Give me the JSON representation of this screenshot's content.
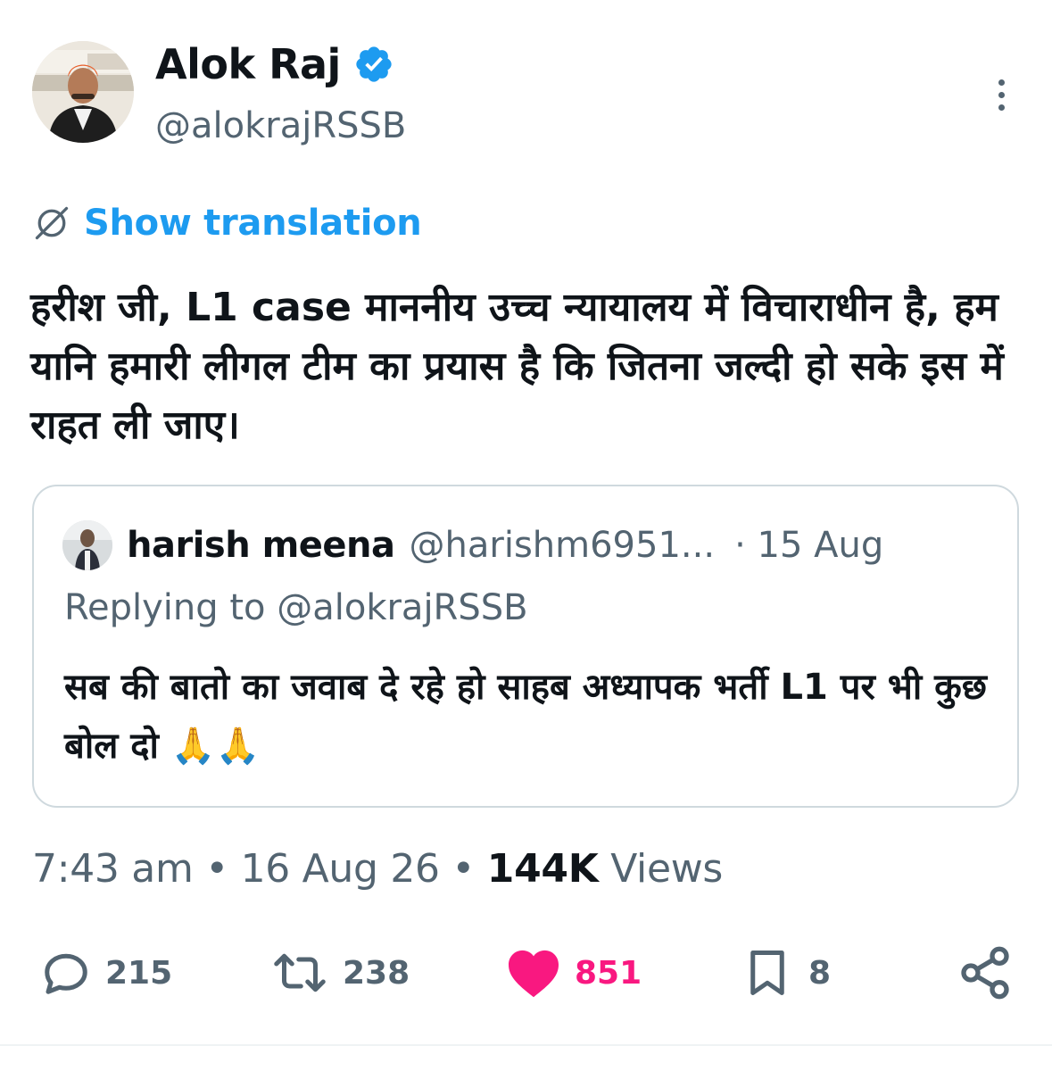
{
  "author": {
    "name": "Alok Raj",
    "handle": "@alokrajRSSB"
  },
  "show_translation_label": "Show translation",
  "tweet_text": "हरीश जी, L1 case माननीय उच्च न्यायालय में विचाराधीन है, हम यानि हमारी लीगल टीम का प्रयास है कि जितना जल्दी हो सके इस में राहत ली जाए।",
  "quoted": {
    "name": "harish meena",
    "handle": "@harishm6951...",
    "date": "· 15 Aug",
    "replying_to": "Replying to @alokrajRSSB",
    "text": "सब की बातो का जवाब दे रहे हो साहब अध्यापक भर्ती L1 पर भी कुछ बोल दो 🙏🙏"
  },
  "meta": {
    "time": "7:43 am",
    "date": "16 Aug 26",
    "views_count": "144K",
    "views_label": "Views"
  },
  "actions": {
    "replies": "215",
    "reposts": "238",
    "likes": "851",
    "bookmarks": "8"
  },
  "colors": {
    "accent": "#1d9bf0",
    "like": "#f91880",
    "secondary_text": "#536471",
    "text": "#0f1419",
    "border": "#cfd9de"
  },
  "icons": [
    "verified-badge-icon",
    "more-icon",
    "translate-icon",
    "reply-icon",
    "repost-icon",
    "like-icon",
    "bookmark-icon",
    "share-icon"
  ]
}
